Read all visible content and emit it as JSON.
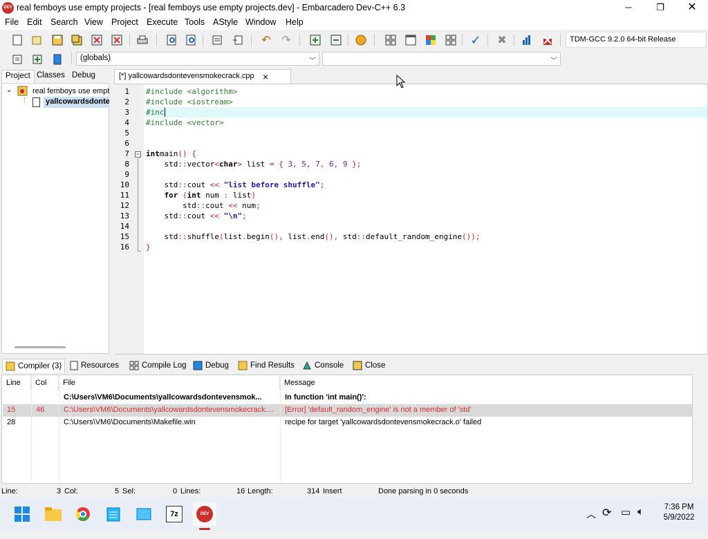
{
  "window": {
    "title": "real femboys use empty projects - [real femboys use empty projects.dev] - Embarcadero Dev-C++ 6.3",
    "icon_label": "DEV C++"
  },
  "menu": [
    "File",
    "Edit",
    "Search",
    "View",
    "Project",
    "Execute",
    "Tools",
    "AStyle",
    "Window",
    "Help"
  ],
  "toolbar": {
    "compiler": "TDM-GCC 9.2.0 64-bit Release",
    "scope": "(globals)"
  },
  "left_tabs": [
    "Project",
    "Classes",
    "Debug"
  ],
  "tree": {
    "project": "real femboys use empt",
    "file": "yallcowardsdontev"
  },
  "editor": {
    "tab": "[*] yallcowardsdontevensmokecrack.cpp",
    "close": "×"
  },
  "code": [
    {
      "n": "1",
      "segs": [
        [
          "pp",
          "#include <algorithm>"
        ]
      ]
    },
    {
      "n": "2",
      "segs": [
        [
          "pp",
          "#include <iostream>"
        ]
      ]
    },
    {
      "n": "3",
      "segs": [
        [
          "pp",
          "#inc"
        ]
      ],
      "hl": true
    },
    {
      "n": "4",
      "segs": [
        [
          "pp",
          "#include <vector>"
        ]
      ]
    },
    {
      "n": "5",
      "segs": []
    },
    {
      "n": "6",
      "segs": []
    },
    {
      "n": "7",
      "segs": [
        [
          "kw",
          "int"
        ],
        [
          "",
          "main"
        ],
        [
          "op",
          "()"
        ],
        [
          "",
          ""
        ],
        [
          "op",
          " {"
        ]
      ]
    },
    {
      "n": "8",
      "segs": [
        [
          "",
          "    std"
        ],
        [
          "op",
          "::"
        ],
        [
          "",
          "vector"
        ],
        [
          "op",
          "<"
        ],
        [
          "kw",
          "char"
        ],
        [
          "op",
          "> "
        ],
        [
          "",
          "list "
        ],
        [
          "op",
          "= { "
        ],
        [
          "num",
          "3"
        ],
        [
          "op",
          ", "
        ],
        [
          "num",
          "5"
        ],
        [
          "op",
          ", "
        ],
        [
          "num",
          "7"
        ],
        [
          "op",
          ", "
        ],
        [
          "num",
          "6"
        ],
        [
          "op",
          ", "
        ],
        [
          "num",
          "9"
        ],
        [
          "op",
          " };"
        ]
      ]
    },
    {
      "n": "9",
      "segs": []
    },
    {
      "n": "10",
      "segs": [
        [
          "",
          "    std"
        ],
        [
          "op",
          "::"
        ],
        [
          "",
          "cout "
        ],
        [
          "op",
          "<< "
        ],
        [
          "str",
          "\"list before shuffle\""
        ],
        [
          "op",
          ";"
        ]
      ]
    },
    {
      "n": "11",
      "segs": [
        [
          "kw",
          "    for "
        ],
        [
          "op",
          "("
        ],
        [
          "kw",
          "int"
        ],
        [
          "",
          " num "
        ],
        [
          "op",
          ": "
        ],
        [
          "",
          "list"
        ],
        [
          "op",
          ")"
        ]
      ]
    },
    {
      "n": "12",
      "segs": [
        [
          "",
          "        std"
        ],
        [
          "op",
          "::"
        ],
        [
          "",
          "cout "
        ],
        [
          "op",
          "<< "
        ],
        [
          "",
          "num"
        ],
        [
          "op",
          ";"
        ]
      ]
    },
    {
      "n": "13",
      "segs": [
        [
          "",
          "    std"
        ],
        [
          "op",
          "::"
        ],
        [
          "",
          "cout "
        ],
        [
          "op",
          "<< "
        ],
        [
          "str",
          "\"\\n\""
        ],
        [
          "op",
          ";"
        ]
      ]
    },
    {
      "n": "14",
      "segs": []
    },
    {
      "n": "15",
      "segs": [
        [
          "",
          "    std"
        ],
        [
          "op",
          "::"
        ],
        [
          "",
          "shuffle"
        ],
        [
          "op",
          "("
        ],
        [
          "",
          "list"
        ],
        [
          "op",
          "."
        ],
        [
          "",
          "begin"
        ],
        [
          "op",
          "(), "
        ],
        [
          "",
          "list"
        ],
        [
          "op",
          "."
        ],
        [
          "",
          "end"
        ],
        [
          "op",
          "(), "
        ],
        [
          "",
          "std"
        ],
        [
          "op",
          "::"
        ],
        [
          "",
          "default_random_engine"
        ],
        [
          "op",
          "());"
        ]
      ]
    },
    {
      "n": "16",
      "segs": [
        [
          "op",
          "}"
        ]
      ]
    }
  ],
  "bottom_tabs": [
    "Compiler (3)",
    "Resources",
    "Compile Log",
    "Debug",
    "Find Results",
    "Console",
    "Close"
  ],
  "messages": {
    "headers": [
      "Line",
      "Col",
      "File",
      "Message"
    ],
    "rows": [
      {
        "line": "",
        "col": "",
        "file": "C:\\Users\\VM6\\Documents\\yallcowardsdontevensmok...",
        "msg": "In function 'int main()':",
        "bold": true
      },
      {
        "line": "15",
        "col": "46",
        "file": "C:\\Users\\VM6\\Documents\\yallcowardsdontevensmokecrack....",
        "msg": "[Error] 'default_random_engine' is not a member of 'std'",
        "error": true
      },
      {
        "line": "28",
        "col": "",
        "file": "C:\\Users\\VM6\\Documents\\Makefile.win",
        "msg": "recipe for target 'yallcowardsdontevensmokecrack.o' failed"
      }
    ]
  },
  "status": {
    "line_label": "Line:",
    "line": "3",
    "col_label": "Col:",
    "col": "5",
    "sel_label": "Sel:",
    "sel": "0",
    "lines_label": "Lines:",
    "lines": "16",
    "length_label": "Length:",
    "length": "314",
    "mode": "Insert",
    "parse": "Done parsing in 0 seconds"
  },
  "taskbar": {
    "time": "7:36 PM",
    "date": "5/9/2022"
  }
}
